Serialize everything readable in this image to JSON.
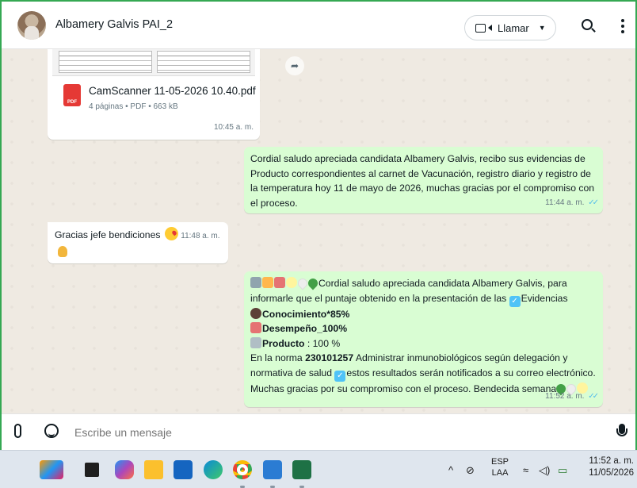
{
  "header": {
    "contact_name": "Albamery Galvis PAI_2",
    "call_label": "Llamar"
  },
  "messages": {
    "pdf": {
      "file_name": "CamScanner 11-05-2026 10.40.pdf",
      "meta": "4 páginas • PDF • 663 kB",
      "time": "10:45 a. m.",
      "icon_label": "PDF"
    },
    "msg1": {
      "text": "Cordial saludo apreciada candidata Albamery Galvis, recibo sus evidencias de Producto correspondientes al carnet de Vacunación, registro diario y registro de la temperatura hoy 11 de mayo de 2026, muchas gracias por el compromiso con el proceso.",
      "time": "11:44 a. m."
    },
    "msg2": {
      "text": "Gracias jefe bendiciones",
      "time": "11:48 a. m."
    },
    "msg3": {
      "line1": "Cordial saludo apreciada candidata Albamery Galvis, para informarle que el puntaje obtenido en la presentación de las",
      "line1_tail": "Evidencias",
      "conocimiento": "Conocimiento*85%",
      "desempeno": "Desempeño_100%",
      "producto_label": "Producto",
      "producto_value": " : 100 %",
      "norma_prefix": "En la norma ",
      "norma_code": "230101257",
      "norma_text": " Administrar inmunobiológicos según delegación y normativa de salud ",
      "closing": "estos resultados serán notificados a su correo electrónico. Muchas gracias por su compromiso con el proceso. Bendecida semana",
      "time": "11:52 a. m."
    }
  },
  "composer": {
    "placeholder": "Escribe un mensaje"
  },
  "taskbar": {
    "lang_top": "ESP",
    "lang_bottom": "LAA",
    "time": "11:52 a. m.",
    "date": "11/05/2026",
    "apps": [
      "gallery",
      "files",
      "copilot",
      "explorer",
      "store",
      "edge",
      "chrome",
      "word",
      "excel"
    ]
  },
  "icons": {
    "accent_green": "#d9fdd3",
    "tick_color": "#53bdeb",
    "frame_color": "#35a853"
  }
}
